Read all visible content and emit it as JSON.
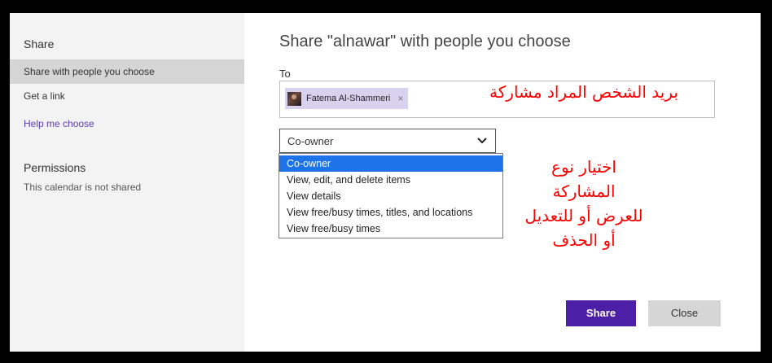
{
  "sidebar": {
    "title": "Share",
    "items": [
      {
        "label": "Share with people you choose"
      },
      {
        "label": "Get a link"
      },
      {
        "label": "Help me choose"
      }
    ],
    "permissions_title": "Permissions",
    "permissions_text": "This calendar is not shared"
  },
  "main": {
    "title": "Share \"alnawar\" with people you choose",
    "to_label": "To",
    "recipient": {
      "name": "Fatema Al-Shammeri",
      "remove": "×"
    },
    "permission_select": {
      "selected": "Co-owner",
      "options": [
        "Co-owner",
        "View, edit, and delete items",
        "View details",
        "View free/busy times, titles, and locations",
        "View free/busy times"
      ]
    },
    "share_button": "Share",
    "close_button": "Close"
  },
  "annotations": {
    "email_note": "بريد الشخص المراد مشاركة",
    "type_note_lines": [
      "اختيار نوع",
      "المشاركة",
      "للعرض أو للتعديل",
      "أو الحذف"
    ],
    "color": "#ff0000"
  },
  "colors": {
    "accent": "#4b1fa6",
    "chip": "#d9d2ee",
    "dropdown_highlight": "#1e73e8",
    "sidebar_bg": "#f3f3f3"
  }
}
